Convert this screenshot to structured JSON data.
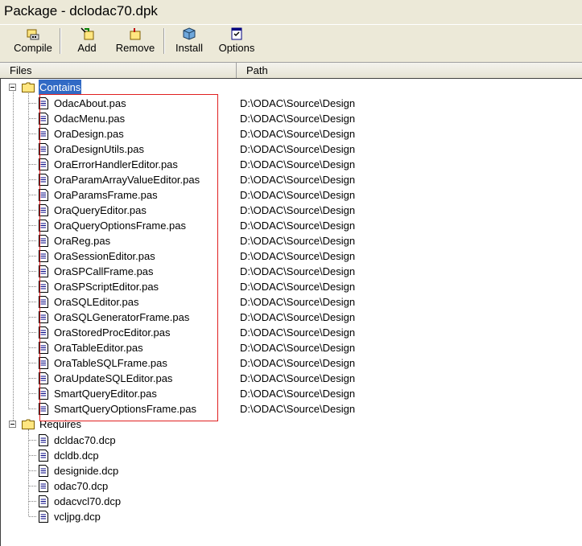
{
  "window": {
    "title": "Package - dclodac70.dpk"
  },
  "toolbar": {
    "compile_label": "Compile",
    "add_label": "Add",
    "remove_label": "Remove",
    "install_label": "Install",
    "options_label": "Options"
  },
  "columns": {
    "files": "Files",
    "path": "Path"
  },
  "tree": {
    "contains": {
      "label": "Contains",
      "files": [
        {
          "name": "OdacAbout.pas",
          "path": "D:\\ODAC\\Source\\Design"
        },
        {
          "name": "OdacMenu.pas",
          "path": "D:\\ODAC\\Source\\Design"
        },
        {
          "name": "OraDesign.pas",
          "path": "D:\\ODAC\\Source\\Design"
        },
        {
          "name": "OraDesignUtils.pas",
          "path": "D:\\ODAC\\Source\\Design"
        },
        {
          "name": "OraErrorHandlerEditor.pas",
          "path": "D:\\ODAC\\Source\\Design"
        },
        {
          "name": "OraParamArrayValueEditor.pas",
          "path": "D:\\ODAC\\Source\\Design"
        },
        {
          "name": "OraParamsFrame.pas",
          "path": "D:\\ODAC\\Source\\Design"
        },
        {
          "name": "OraQueryEditor.pas",
          "path": "D:\\ODAC\\Source\\Design"
        },
        {
          "name": "OraQueryOptionsFrame.pas",
          "path": "D:\\ODAC\\Source\\Design"
        },
        {
          "name": "OraReg.pas",
          "path": "D:\\ODAC\\Source\\Design"
        },
        {
          "name": "OraSessionEditor.pas",
          "path": "D:\\ODAC\\Source\\Design"
        },
        {
          "name": "OraSPCallFrame.pas",
          "path": "D:\\ODAC\\Source\\Design"
        },
        {
          "name": "OraSPScriptEditor.pas",
          "path": "D:\\ODAC\\Source\\Design"
        },
        {
          "name": "OraSQLEditor.pas",
          "path": "D:\\ODAC\\Source\\Design"
        },
        {
          "name": "OraSQLGeneratorFrame.pas",
          "path": "D:\\ODAC\\Source\\Design"
        },
        {
          "name": "OraStoredProcEditor.pas",
          "path": "D:\\ODAC\\Source\\Design"
        },
        {
          "name": "OraTableEditor.pas",
          "path": "D:\\ODAC\\Source\\Design"
        },
        {
          "name": "OraTableSQLFrame.pas",
          "path": "D:\\ODAC\\Source\\Design"
        },
        {
          "name": "OraUpdateSQLEditor.pas",
          "path": "D:\\ODAC\\Source\\Design"
        },
        {
          "name": "SmartQueryEditor.pas",
          "path": "D:\\ODAC\\Source\\Design"
        },
        {
          "name": "SmartQueryOptionsFrame.pas",
          "path": "D:\\ODAC\\Source\\Design"
        }
      ]
    },
    "requires": {
      "label": "Requires",
      "files": [
        {
          "name": "dcldac70.dcp",
          "path": ""
        },
        {
          "name": "dcldb.dcp",
          "path": ""
        },
        {
          "name": "designide.dcp",
          "path": ""
        },
        {
          "name": "odac70.dcp",
          "path": ""
        },
        {
          "name": "odacvcl70.dcp",
          "path": ""
        },
        {
          "name": "vcljpg.dcp",
          "path": ""
        }
      ]
    }
  },
  "colors": {
    "selection": "#316ac5",
    "highlight_box": "#e02020"
  }
}
